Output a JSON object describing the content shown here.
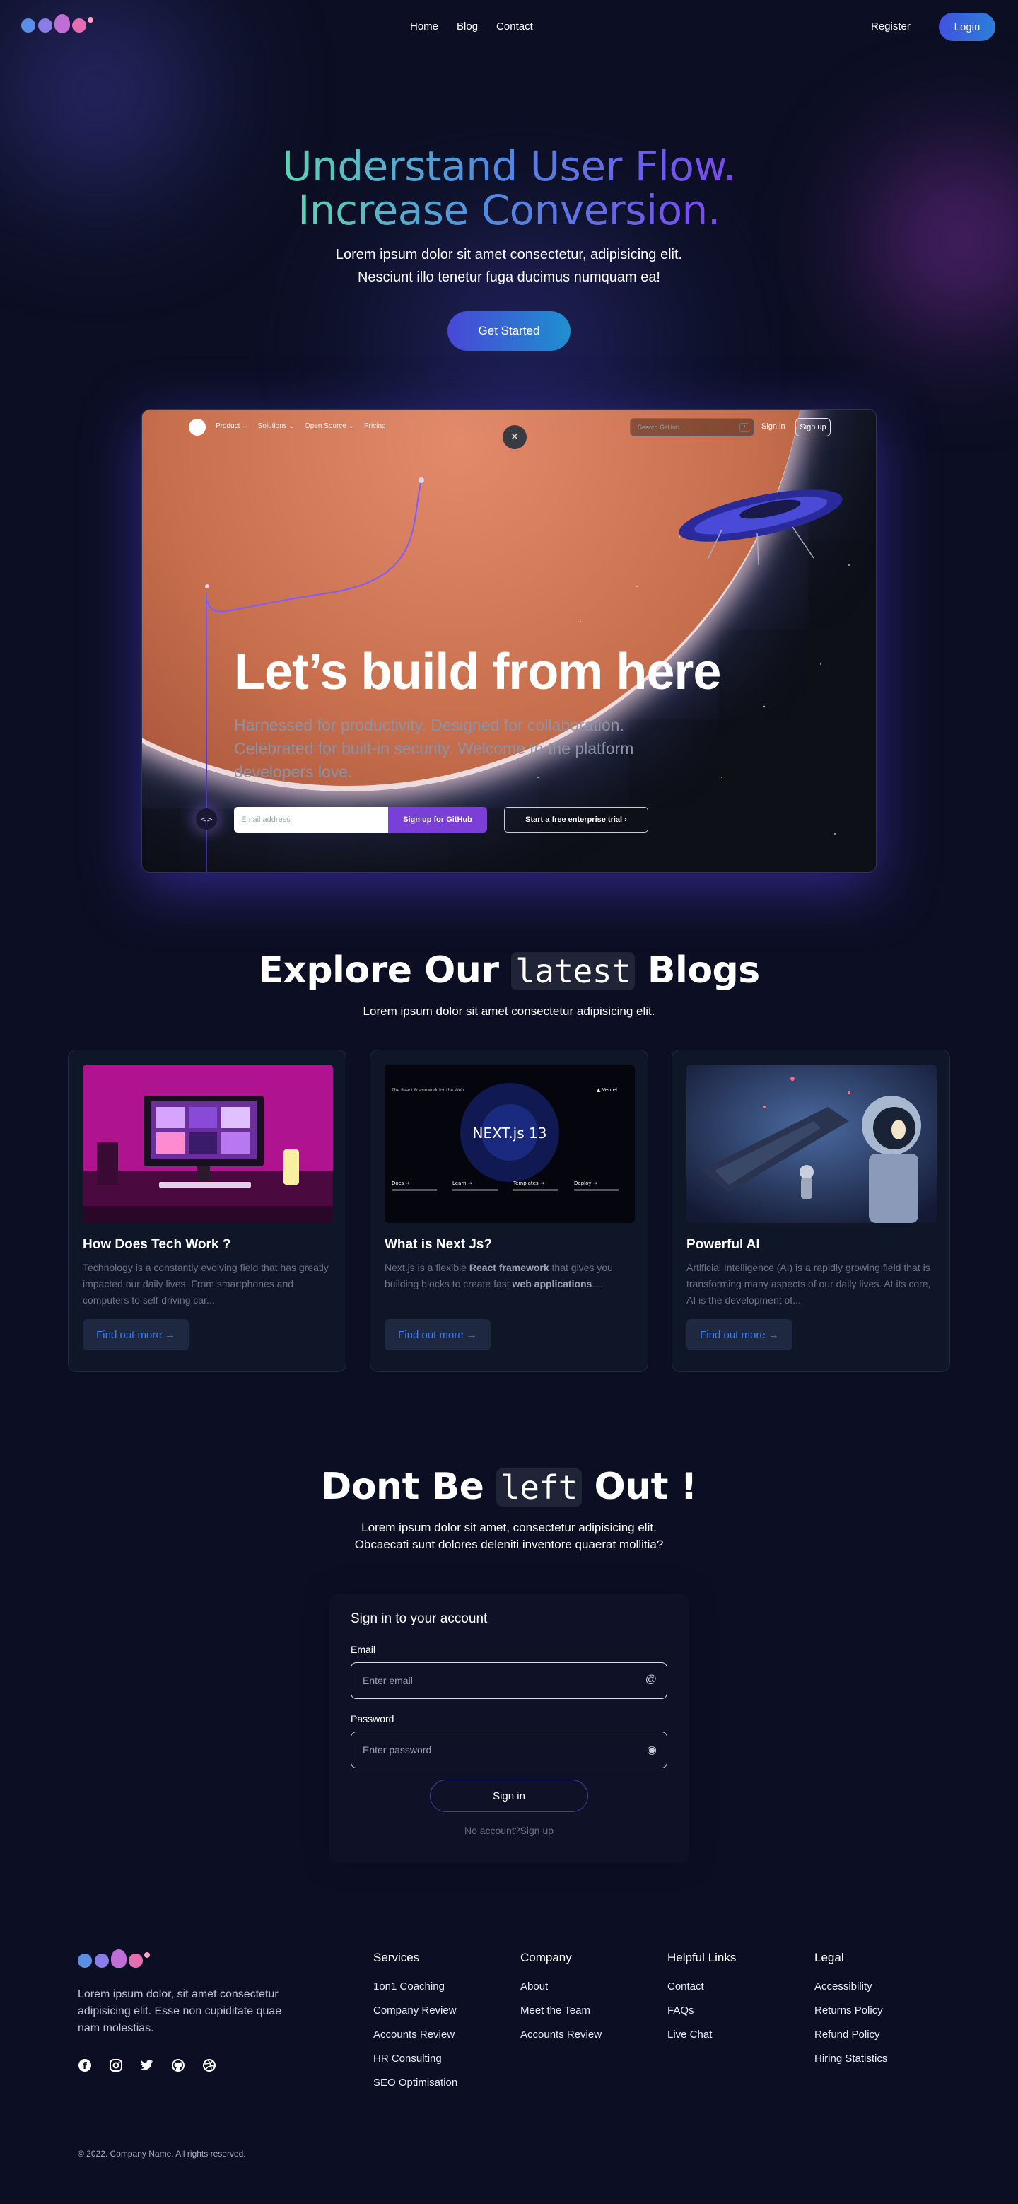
{
  "nav": {
    "links": [
      "Home",
      "Blog",
      "Contact"
    ],
    "register": "Register",
    "login": "Login"
  },
  "hero": {
    "title_line1": "Understand User Flow.",
    "title_line2": "Increase Conversion.",
    "sub_line1": "Lorem ipsum dolor sit amet consectetur, adipisicing elit.",
    "sub_line2": "Nesciunt illo tenetur fuga ducimus numquam ea!",
    "cta": "Get Started"
  },
  "showcase": {
    "nav_items": [
      "Product ⌄",
      "Solutions ⌄",
      "Open Source ⌄",
      "Pricing"
    ],
    "search_placeholder": "Search GitHub",
    "search_key": "/",
    "signin": "Sign in",
    "signup": "Sign up",
    "title": "Let’s build from here",
    "sub": "Harnessed for productivity. Designed for collaboration. Celebrated for built-in security. Welcome to the platform developers love.",
    "email_placeholder": "Email address",
    "signup_cta": "Sign up for GitHub",
    "trial_cta": "Start a free enterprise trial ›"
  },
  "blogs": {
    "title_pre": "Explore Our",
    "title_code": "latest",
    "title_post": "Blogs",
    "subtitle": "Lorem ipsum dolor sit amet consectetur adipisicing elit.",
    "cards": [
      {
        "title": "How Does Tech Work ?",
        "desc": "Technology is a constantly evolving field that has greatly impacted our daily lives. From smartphones and computers to self-driving car...",
        "button": "Find out more →"
      },
      {
        "title": "What is Next Js?",
        "desc_a": "Next.js is a flexible ",
        "desc_b": "React framework",
        "desc_c": " that gives you building blocks to create fast ",
        "desc_d": "web applications",
        "desc_e": "....",
        "button": "Find out more →"
      },
      {
        "title": "Powerful AI",
        "desc": "Artificial Intelligence (AI) is a rapidly growing field that is transforming many aspects of our daily lives. At its core, AI is the development of...",
        "button": "Find out more →"
      }
    ]
  },
  "signin_section": {
    "title_pre": "Dont Be",
    "title_code": "left",
    "title_post": "Out !",
    "subtitle": "Lorem ipsum dolor sit amet, consectetur adipisicing elit. Obcaecati sunt dolores deleniti inventore quaerat mollitia?",
    "form_title": "Sign in to your account",
    "email_label": "Email",
    "email_placeholder": "Enter email",
    "password_label": "Password",
    "password_placeholder": "Enter password",
    "submit": "Sign in",
    "no_account": "No account?",
    "signup_link": "Sign up"
  },
  "footer": {
    "description": "Lorem ipsum dolor, sit amet consectetur adipisicing elit. Esse non cupiditate quae nam molestias.",
    "social_icons": [
      "facebook-icon",
      "instagram-icon",
      "twitter-icon",
      "github-icon",
      "dribbble-icon"
    ],
    "columns": [
      {
        "heading": "Services",
        "items": [
          "1on1 Coaching",
          "Company Review",
          "Accounts Review",
          "HR Consulting",
          "SEO Optimisation"
        ]
      },
      {
        "heading": "Company",
        "items": [
          "About",
          "Meet the Team",
          "Accounts Review"
        ]
      },
      {
        "heading": "Helpful Links",
        "items": [
          "Contact",
          "FAQs",
          "Live Chat"
        ]
      },
      {
        "heading": "Legal",
        "items": [
          "Accessibility",
          "Returns Policy",
          "Refund Policy",
          "Hiring Statistics"
        ]
      }
    ],
    "copyright": "© 2022. Company Name. All rights reserved."
  },
  "colors": {
    "background": "#0c0f24",
    "accent_blue": "#3d7bf2",
    "gradient_start": "#5fd3b4",
    "gradient_end": "#7a48e8",
    "github_purple": "#7a3fd6"
  }
}
